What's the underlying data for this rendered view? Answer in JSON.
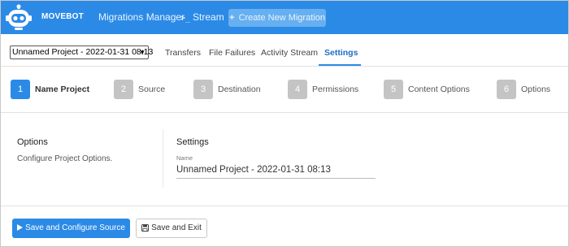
{
  "header": {
    "brand": "MOVEBOT",
    "nav": {
      "migrations_manager": "Migrations Manager",
      "stream": "Stream",
      "stream_prefix": ">_"
    },
    "create_button": "Create New Migration",
    "create_button_icon": "plus-icon",
    "accent_color": "#2b8ae6"
  },
  "project": {
    "selected": "Unnamed Project - 2022-01-31 08:13"
  },
  "tabs": [
    {
      "label": "Transfers",
      "active": false
    },
    {
      "label": "File Failures",
      "active": false
    },
    {
      "label": "Activity Stream",
      "active": false
    },
    {
      "label": "Settings",
      "active": true
    }
  ],
  "steps": [
    {
      "number": "1",
      "label": "Name Project",
      "active": true
    },
    {
      "number": "2",
      "label": "Source",
      "active": false
    },
    {
      "number": "3",
      "label": "Destination",
      "active": false
    },
    {
      "number": "4",
      "label": "Permissions",
      "active": false
    },
    {
      "number": "5",
      "label": "Content Options",
      "active": false
    },
    {
      "number": "6",
      "label": "Options",
      "active": false
    }
  ],
  "options_panel": {
    "title": "Options",
    "description": "Configure Project Options."
  },
  "settings_panel": {
    "title": "Settings",
    "name_label": "Name",
    "name_value": "Unnamed Project - 2022-01-31 08:13"
  },
  "actions": {
    "primary": "Save and Configure Source",
    "primary_icon": "play-icon",
    "secondary": "Save and Exit",
    "secondary_icon": "floppy-disk-icon"
  }
}
